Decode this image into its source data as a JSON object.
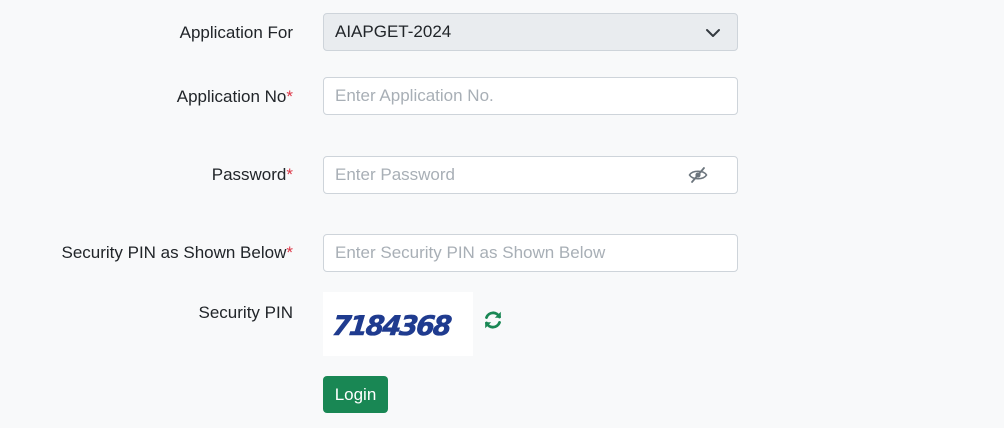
{
  "form": {
    "application_for": {
      "label": "Application For",
      "selected": "AIAPGET-2024"
    },
    "application_no": {
      "label": "Application No",
      "required_mark": "*",
      "placeholder": "Enter Application No.",
      "value": ""
    },
    "password": {
      "label": "Password",
      "required_mark": "*",
      "placeholder": "Enter Password",
      "value": "",
      "toggle_icon": "eye-slash-icon"
    },
    "security_pin_input": {
      "label": "Security PIN as Shown Below",
      "required_mark": "*",
      "placeholder": "Enter Security PIN as Shown Below",
      "value": ""
    },
    "security_pin": {
      "label": "Security PIN",
      "captcha_text": "7184368",
      "refresh_icon": "refresh-icon"
    },
    "login_label": "Login"
  },
  "colors": {
    "page_background": "#f8f9fa",
    "required": "#dc3545",
    "login_button": "#198754",
    "refresh_icon": "#198754",
    "captcha_text": "#1f3b8f",
    "select_background": "#e9ecef"
  }
}
